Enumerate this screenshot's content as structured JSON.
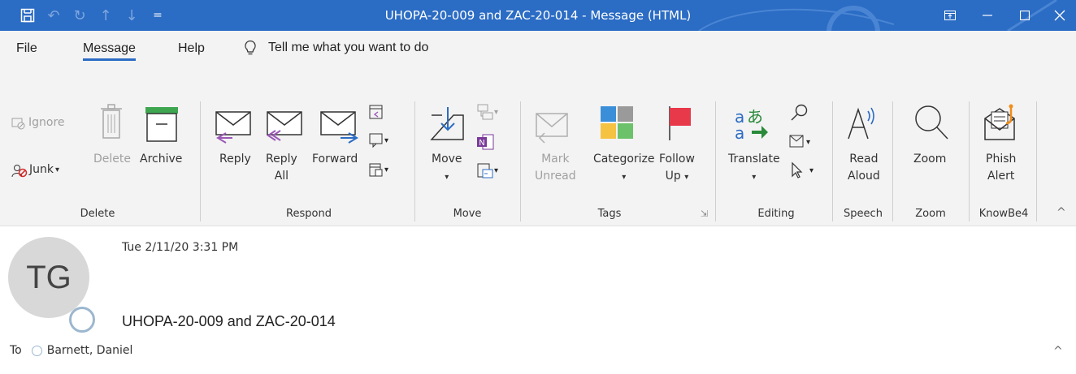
{
  "window": {
    "title": "UHOPA-20-009 and ZAC-20-014  -  Message (HTML)",
    "qat_customize": "="
  },
  "menu": {
    "tabs": [
      "File",
      "Message",
      "Help"
    ],
    "tell_me": "Tell me what you want to do"
  },
  "ribbon": {
    "delete_group": {
      "label": "Delete",
      "ignore": "Ignore",
      "junk": "Junk",
      "delete": "Delete",
      "archive": "Archive"
    },
    "respond_group": {
      "label": "Respond",
      "reply": "Reply",
      "reply_all_1": "Reply",
      "reply_all_2": "All",
      "forward": "Forward"
    },
    "move_group": {
      "label": "Move",
      "move": "Move"
    },
    "tags_group": {
      "label": "Tags",
      "mark_1": "Mark",
      "mark_2": "Unread",
      "categorize": "Categorize",
      "follow_1": "Follow",
      "follow_2": "Up"
    },
    "editing_group": {
      "label": "Editing",
      "translate": "Translate"
    },
    "speech_group": {
      "label": "Speech",
      "read_1": "Read",
      "read_2": "Aloud"
    },
    "zoom_group": {
      "label": "Zoom",
      "zoom": "Zoom"
    },
    "knowbe4_group": {
      "label": "KnowBe4",
      "phish_1": "Phish",
      "phish_2": "Alert"
    }
  },
  "message": {
    "avatar_initials": "TG",
    "date": "Tue 2/11/20 3:31 PM",
    "subject": "UHOPA-20-009 and ZAC-20-014",
    "to_label": "To",
    "recipient": "Barnett, Daniel"
  }
}
